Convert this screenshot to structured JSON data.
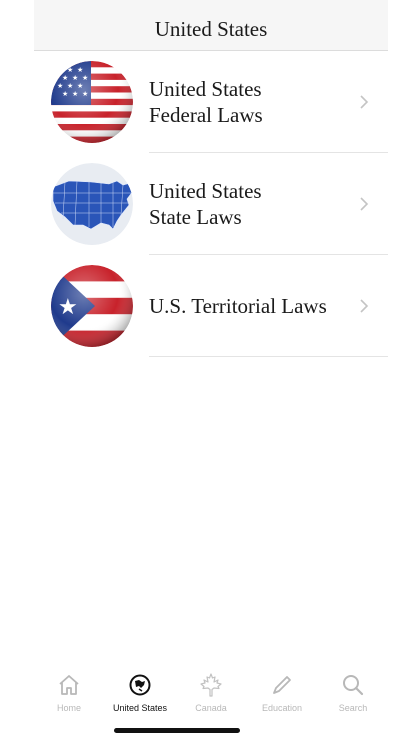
{
  "navbar": {
    "title": "United States"
  },
  "list": {
    "items": [
      {
        "label": "United States\nFederal Laws",
        "icon": "us-flag-icon"
      },
      {
        "label": "United States\nState Laws",
        "icon": "us-map-icon"
      },
      {
        "label": "U.S. Territorial Laws",
        "icon": "puerto-rico-flag-icon"
      }
    ]
  },
  "tabbar": {
    "items": [
      {
        "label": "Home",
        "icon": "home-icon",
        "active": false
      },
      {
        "label": "United States",
        "icon": "united-states-icon",
        "active": true
      },
      {
        "label": "Canada",
        "icon": "maple-leaf-icon",
        "active": false
      },
      {
        "label": "Education",
        "icon": "pencil-icon",
        "active": false
      },
      {
        "label": "Search",
        "icon": "search-icon",
        "active": false
      }
    ]
  },
  "colors": {
    "flag_red": "#c8222b",
    "flag_blue": "#1f3a8c",
    "active_tab": "#111111",
    "inactive_tab": "#b8b8b8"
  }
}
